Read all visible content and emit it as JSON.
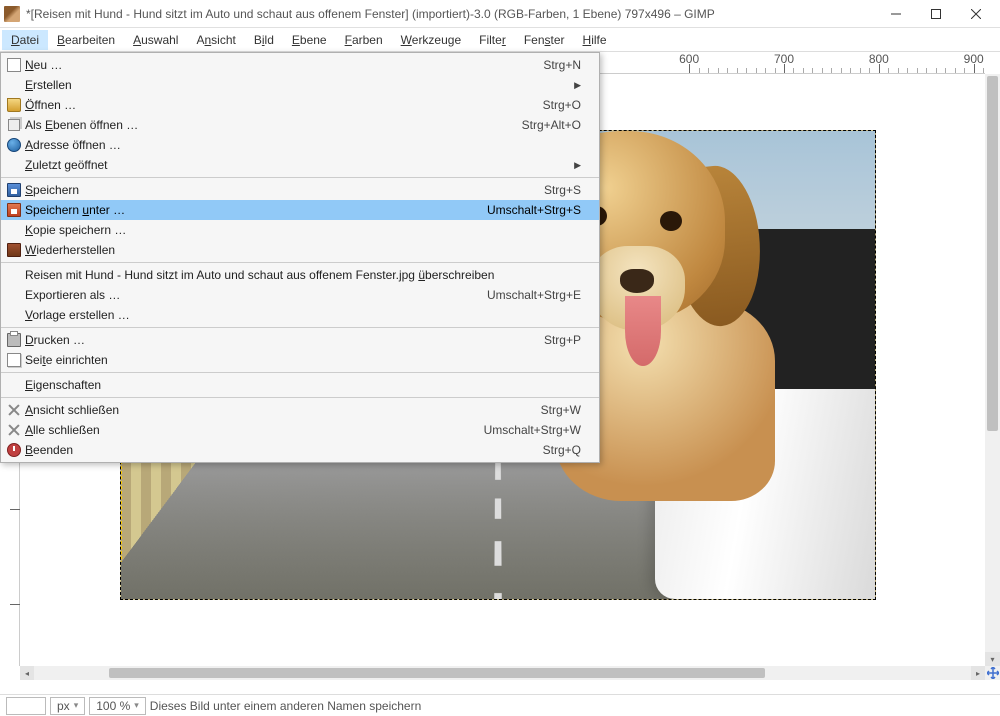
{
  "titlebar": {
    "title": "*[Reisen mit Hund - Hund sitzt im Auto und schaut aus offenem Fenster] (importiert)-3.0 (RGB-Farben, 1 Ebene) 797x496 – GIMP"
  },
  "menubar": {
    "items": [
      {
        "label": "Datei",
        "active": true,
        "ul": "D"
      },
      {
        "label": "Bearbeiten",
        "ul": "B"
      },
      {
        "label": "Auswahl",
        "ul": "A"
      },
      {
        "label": "Ansicht",
        "ul": "n"
      },
      {
        "label": "Bild",
        "ul": "i"
      },
      {
        "label": "Ebene",
        "ul": "E"
      },
      {
        "label": "Farben",
        "ul": "F"
      },
      {
        "label": "Werkzeuge",
        "ul": "W"
      },
      {
        "label": "Filter",
        "ul": "r"
      },
      {
        "label": "Fenster",
        "ul": "s"
      },
      {
        "label": "Hilfe",
        "ul": "H"
      }
    ]
  },
  "dropdown": {
    "groups": [
      [
        {
          "label": "Neu …",
          "shortcut": "Strg+N",
          "icon": "new",
          "ul": "N"
        },
        {
          "label": "Erstellen",
          "submenu": true,
          "ul": "E"
        },
        {
          "label": "Öffnen …",
          "shortcut": "Strg+O",
          "icon": "open",
          "ul": "Ö"
        },
        {
          "label": "Als Ebenen öffnen …",
          "shortcut": "Strg+Alt+O",
          "icon": "layers",
          "ul": "E"
        },
        {
          "label": "Adresse öffnen …",
          "icon": "globe",
          "ul": "A"
        },
        {
          "label": "Zuletzt geöffnet",
          "submenu": true,
          "ul": "Z"
        }
      ],
      [
        {
          "label": "Speichern",
          "shortcut": "Strg+S",
          "icon": "save",
          "ul": "S"
        },
        {
          "label": "Speichern unter …",
          "shortcut": "Umschalt+Strg+S",
          "icon": "saveas",
          "highlight": true,
          "ul": "u"
        },
        {
          "label": "Kopie speichern …",
          "ul": "K"
        },
        {
          "label": "Wiederherstellen",
          "icon": "revert",
          "ul": "W"
        }
      ],
      [
        {
          "label": "Reisen mit Hund - Hund sitzt im Auto und schaut aus offenem Fenster.jpg überschreiben",
          "ul": "ü"
        },
        {
          "label": "Exportieren als …",
          "shortcut": "Umschalt+Strg+E"
        },
        {
          "label": "Vorlage erstellen …",
          "ul": "V"
        }
      ],
      [
        {
          "label": "Drucken …",
          "shortcut": "Strg+P",
          "icon": "print",
          "ul": "D"
        },
        {
          "label": "Seite einrichten",
          "icon": "pageset",
          "ul": "t"
        }
      ],
      [
        {
          "label": "Eigenschaften",
          "ul": "E"
        }
      ],
      [
        {
          "label": "Ansicht schließen",
          "shortcut": "Strg+W",
          "icon": "close",
          "ul": "A"
        },
        {
          "label": "Alle schließen",
          "shortcut": "Umschalt+Strg+W",
          "icon": "close",
          "ul": "A"
        },
        {
          "label": "Beenden",
          "shortcut": "Strg+Q",
          "icon": "quit",
          "ul": "B"
        }
      ]
    ]
  },
  "ruler_h": {
    "ticks": [
      600,
      700,
      800,
      900
    ]
  },
  "statusbar": {
    "unit": "px",
    "zoom": "100 %",
    "message": "Dieses Bild unter einem anderen Namen speichern"
  }
}
